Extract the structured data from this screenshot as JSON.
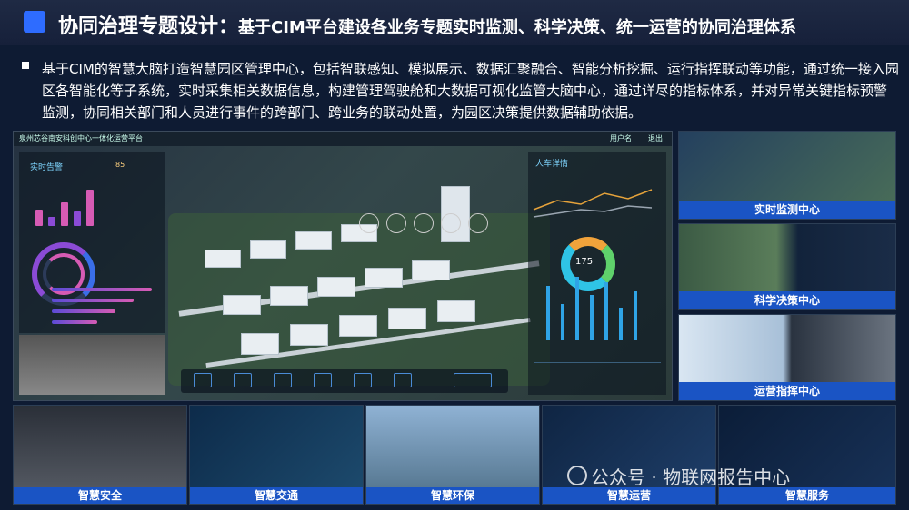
{
  "header": {
    "title": "协同治理专题设计：",
    "subtitle": "基于CIM平台建设各业务专题实时监测、科学决策、统一运营的协同治理体系"
  },
  "intro": {
    "text": "基于CIM的智慧大脑打造智慧园区管理中心，包括智联感知、模拟展示、数据汇聚融合、智能分析挖掘、运行指挥联动等功能，通过统一接入园区各智能化等子系统，实时采集相关数据信息，构建管理驾驶舱和大数据可视化监管大脑中心，通过详尽的指标体系，并对异常关键指标预警监测，协同相关部门和人员进行事件的跨部门、跨业务的联动处置，为园区决策提供数据辅助依据。"
  },
  "dashboard": {
    "title": "泉州芯谷南安科创中心一体化运营平台",
    "user": "用户名",
    "exit": "退出",
    "left_panel_title": "实时告警",
    "left_panel_stat": "85",
    "right_panel_title": "人车详情",
    "donut_value": "175"
  },
  "side_panels": [
    {
      "label": "实时监测中心"
    },
    {
      "label": "科学决策中心"
    },
    {
      "label": "运营指挥中心"
    }
  ],
  "bottom_panels": [
    {
      "label": "智慧安全"
    },
    {
      "label": "智慧交通"
    },
    {
      "label": "智慧环保"
    },
    {
      "label": "智慧运营"
    },
    {
      "label": "智慧服务"
    }
  ],
  "watermark": {
    "text": "公众号 · 物联网报告中心"
  },
  "colors": {
    "accent": "#2e6cff",
    "label_bg": "#1a54c4",
    "background": "#0e1b33"
  }
}
